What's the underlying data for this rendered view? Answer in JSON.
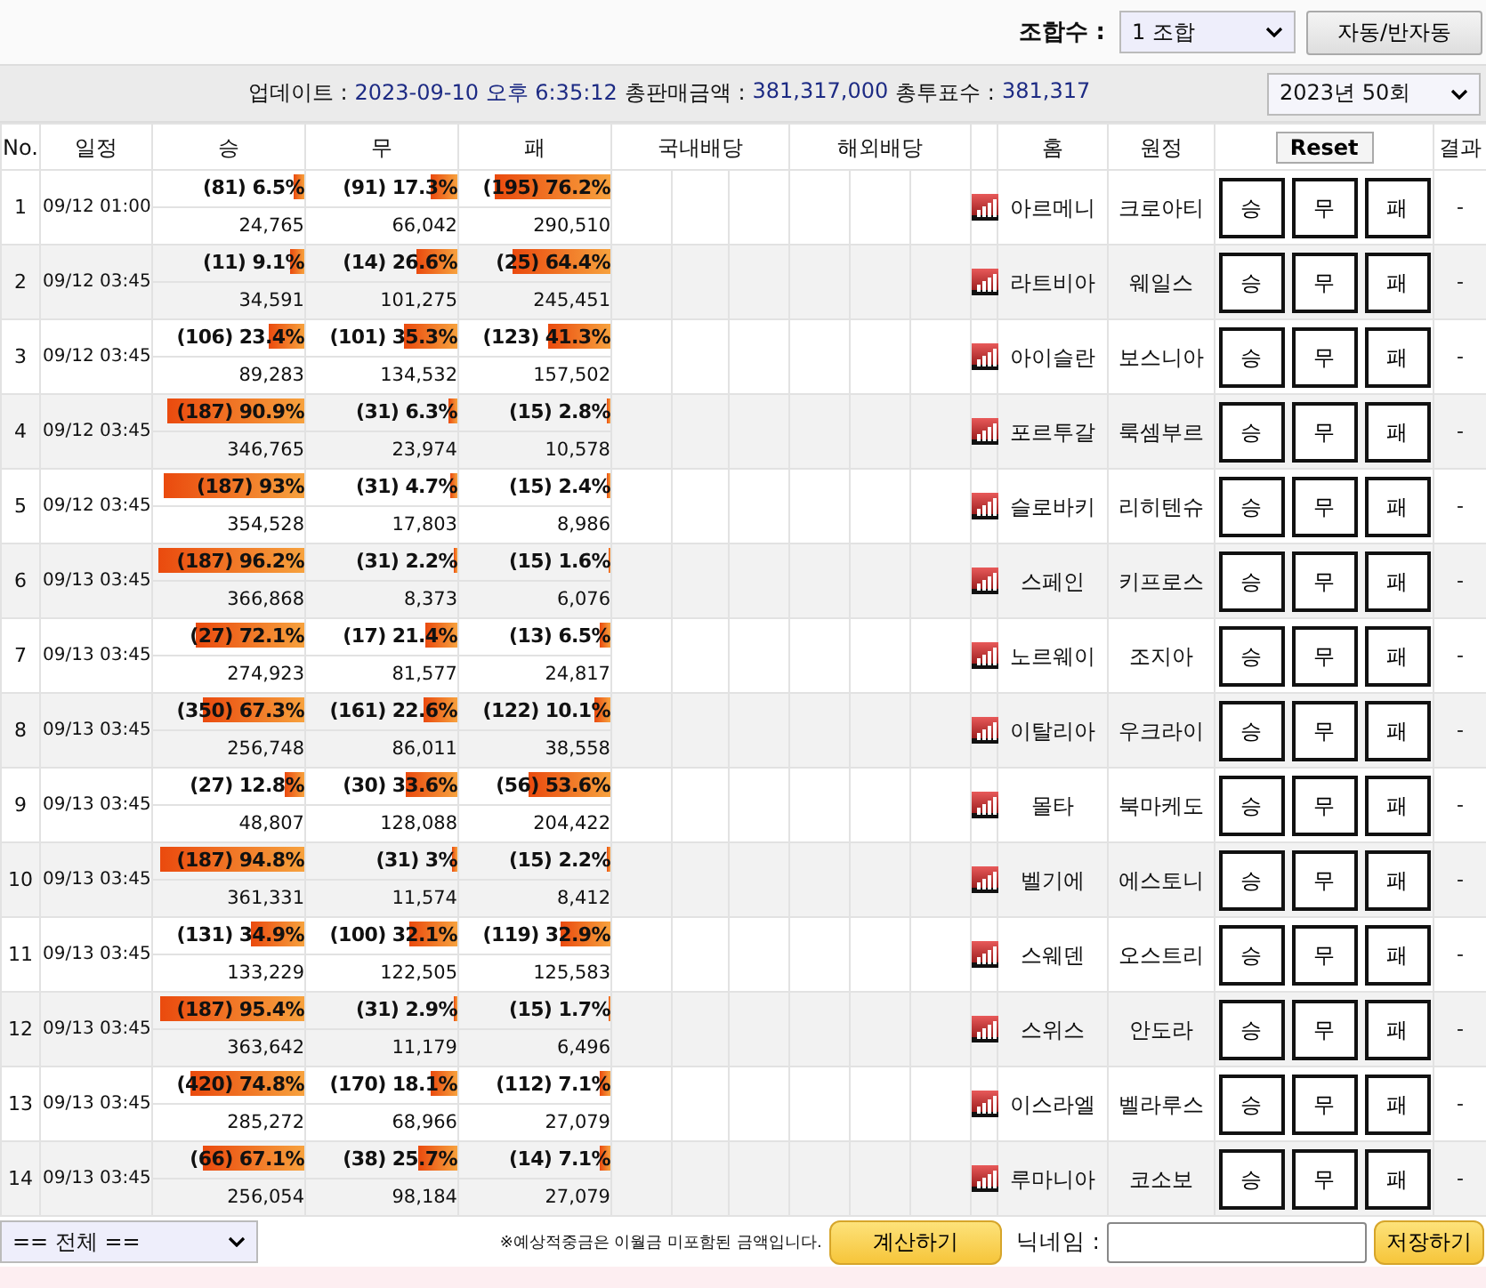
{
  "top_bar": {
    "combo_label": "조합수 :",
    "combo_select": "1 조합",
    "auto_button": "자동/반자동"
  },
  "info_bar": {
    "update_label": "업데이트 :",
    "update_value": "2023-09-10 오후 6:35:12",
    "sales_label": "총판매금액 :",
    "sales_value": "381,317,000",
    "votes_label": "총투표수 :",
    "votes_value": "381,317",
    "round_select": "2023년 50회"
  },
  "table": {
    "columns": [
      "No.",
      "일정",
      "승",
      "무",
      "패",
      "국내배당",
      "해외배당",
      "홈",
      "원정",
      "결과"
    ],
    "reset_button": "Reset",
    "rows": [
      {
        "no": "1",
        "time": "09/12 01:00",
        "picks": [
          {
            "label": "(81) 6.5%",
            "level": 0.065,
            "count": "24,765"
          },
          {
            "label": "(91) 17.3%",
            "level": 0.173,
            "count": "66,042"
          },
          {
            "label": "(195) 76.2%",
            "level": 0.762,
            "count": "290,510"
          }
        ],
        "home": "아르메니",
        "away": "크로아티",
        "choices": [
          "승",
          "무",
          "패"
        ],
        "result": "-"
      },
      {
        "no": "2",
        "time": "09/12 03:45",
        "picks": [
          {
            "label": "(11) 9.1%",
            "level": 0.091,
            "count": "34,591"
          },
          {
            "label": "(14) 26.6%",
            "level": 0.266,
            "count": "101,275"
          },
          {
            "label": "(25) 64.4%",
            "level": 0.644,
            "count": "245,451"
          }
        ],
        "home": "라트비아",
        "away": "웨일스",
        "choices": [
          "승",
          "무",
          "패"
        ],
        "result": "-"
      },
      {
        "no": "3",
        "time": "09/12 03:45",
        "picks": [
          {
            "label": "(106) 23.4%",
            "level": 0.234,
            "count": "89,283"
          },
          {
            "label": "(101) 35.3%",
            "level": 0.353,
            "count": "134,532"
          },
          {
            "label": "(123) 41.3%",
            "level": 0.413,
            "count": "157,502"
          }
        ],
        "home": "아이슬란",
        "away": "보스니아",
        "choices": [
          "승",
          "무",
          "패"
        ],
        "result": "-"
      },
      {
        "no": "4",
        "time": "09/12 03:45",
        "picks": [
          {
            "label": "(187) 90.9%",
            "level": 0.909,
            "count": "346,765"
          },
          {
            "label": "(31) 6.3%",
            "level": 0.063,
            "count": "23,974"
          },
          {
            "label": "(15) 2.8%",
            "level": 0.028,
            "count": "10,578"
          }
        ],
        "home": "포르투갈",
        "away": "룩셈부르",
        "choices": [
          "승",
          "무",
          "패"
        ],
        "result": "-"
      },
      {
        "no": "5",
        "time": "09/12 03:45",
        "picks": [
          {
            "label": "(187) 93%",
            "level": 0.93,
            "count": "354,528"
          },
          {
            "label": "(31) 4.7%",
            "level": 0.047,
            "count": "17,803"
          },
          {
            "label": "(15) 2.4%",
            "level": 0.024,
            "count": "8,986"
          }
        ],
        "home": "슬로바키",
        "away": "리히텐슈",
        "choices": [
          "승",
          "무",
          "패"
        ],
        "result": "-"
      },
      {
        "no": "6",
        "time": "09/13 03:45",
        "picks": [
          {
            "label": "(187) 96.2%",
            "level": 0.962,
            "count": "366,868"
          },
          {
            "label": "(31) 2.2%",
            "level": 0.022,
            "count": "8,373"
          },
          {
            "label": "(15) 1.6%",
            "level": 0.016,
            "count": "6,076"
          }
        ],
        "home": "스페인",
        "away": "키프로스",
        "choices": [
          "승",
          "무",
          "패"
        ],
        "result": "-"
      },
      {
        "no": "7",
        "time": "09/13 03:45",
        "picks": [
          {
            "label": "(27) 72.1%",
            "level": 0.721,
            "count": "274,923"
          },
          {
            "label": "(17) 21.4%",
            "level": 0.214,
            "count": "81,577"
          },
          {
            "label": "(13) 6.5%",
            "level": 0.065,
            "count": "24,817"
          }
        ],
        "home": "노르웨이",
        "away": "조지아",
        "choices": [
          "승",
          "무",
          "패"
        ],
        "result": "-"
      },
      {
        "no": "8",
        "time": "09/13 03:45",
        "picks": [
          {
            "label": "(350) 67.3%",
            "level": 0.673,
            "count": "256,748"
          },
          {
            "label": "(161) 22.6%",
            "level": 0.226,
            "count": "86,011"
          },
          {
            "label": "(122) 10.1%",
            "level": 0.101,
            "count": "38,558"
          }
        ],
        "home": "이탈리아",
        "away": "우크라이",
        "choices": [
          "승",
          "무",
          "패"
        ],
        "result": "-"
      },
      {
        "no": "9",
        "time": "09/13 03:45",
        "picks": [
          {
            "label": "(27) 12.8%",
            "level": 0.128,
            "count": "48,807"
          },
          {
            "label": "(30) 33.6%",
            "level": 0.336,
            "count": "128,088"
          },
          {
            "label": "(56) 53.6%",
            "level": 0.536,
            "count": "204,422"
          }
        ],
        "home": "몰타",
        "away": "북마케도",
        "choices": [
          "승",
          "무",
          "패"
        ],
        "result": "-"
      },
      {
        "no": "10",
        "time": "09/13 03:45",
        "picks": [
          {
            "label": "(187) 94.8%",
            "level": 0.948,
            "count": "361,331"
          },
          {
            "label": "(31) 3%",
            "level": 0.03,
            "count": "11,574"
          },
          {
            "label": "(15) 2.2%",
            "level": 0.022,
            "count": "8,412"
          }
        ],
        "home": "벨기에",
        "away": "에스토니",
        "choices": [
          "승",
          "무",
          "패"
        ],
        "result": "-"
      },
      {
        "no": "11",
        "time": "09/13 03:45",
        "picks": [
          {
            "label": "(131) 34.9%",
            "level": 0.349,
            "count": "133,229"
          },
          {
            "label": "(100) 32.1%",
            "level": 0.321,
            "count": "122,505"
          },
          {
            "label": "(119) 32.9%",
            "level": 0.329,
            "count": "125,583"
          }
        ],
        "home": "스웨덴",
        "away": "오스트리",
        "choices": [
          "승",
          "무",
          "패"
        ],
        "result": "-"
      },
      {
        "no": "12",
        "time": "09/13 03:45",
        "picks": [
          {
            "label": "(187) 95.4%",
            "level": 0.954,
            "count": "363,642"
          },
          {
            "label": "(31) 2.9%",
            "level": 0.029,
            "count": "11,179"
          },
          {
            "label": "(15) 1.7%",
            "level": 0.017,
            "count": "6,496"
          }
        ],
        "home": "스위스",
        "away": "안도라",
        "choices": [
          "승",
          "무",
          "패"
        ],
        "result": "-"
      },
      {
        "no": "13",
        "time": "09/13 03:45",
        "picks": [
          {
            "label": "(420) 74.8%",
            "level": 0.748,
            "count": "285,272"
          },
          {
            "label": "(170) 18.1%",
            "level": 0.181,
            "count": "68,966"
          },
          {
            "label": "(112) 7.1%",
            "level": 0.071,
            "count": "27,079"
          }
        ],
        "home": "이스라엘",
        "away": "벨라루스",
        "choices": [
          "승",
          "무",
          "패"
        ],
        "result": "-"
      },
      {
        "no": "14",
        "time": "09/13 03:45",
        "picks": [
          {
            "label": "(66) 67.1%",
            "level": 0.671,
            "count": "256,054"
          },
          {
            "label": "(38) 25.7%",
            "level": 0.257,
            "count": "98,184"
          },
          {
            "label": "(14) 7.1%",
            "level": 0.071,
            "count": "27,079"
          }
        ],
        "home": "루마니아",
        "away": "코소보",
        "choices": [
          "승",
          "무",
          "패"
        ],
        "result": "-"
      }
    ]
  },
  "footer": {
    "filter_select": "== 전체 ==",
    "note": "※예상적중금은 이월금 미포함된 금액입니다.",
    "calc_button": "계산하기",
    "nickname_label": "닉네임 :",
    "save_button": "저장하기"
  }
}
